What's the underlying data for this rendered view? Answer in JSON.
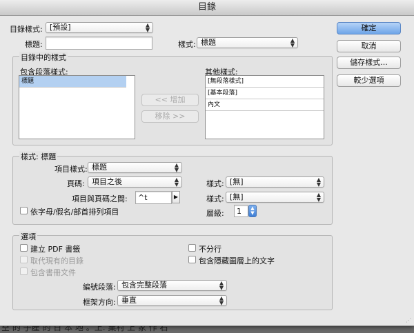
{
  "window": {
    "title": "目錄"
  },
  "top": {
    "toc_style_label": "目錄樣式:",
    "toc_style_value": "[預設]",
    "title_label": "標題:",
    "title_value": "",
    "style_label": "樣式:",
    "style_value": "標題"
  },
  "buttons": {
    "ok": "確定",
    "cancel": "取消",
    "save_style": "儲存樣式...",
    "fewer_options": "較少選項",
    "add": "<< 增加",
    "remove": "移除 >>"
  },
  "styles_in_toc": {
    "group_title": "目錄中的樣式",
    "include_label": "包含段落樣式:",
    "include_items": [
      "標題"
    ],
    "other_label": "其他樣式:",
    "other_items": [
      "[無段落樣式]",
      "[基本段落]",
      "內文"
    ]
  },
  "style_section": {
    "group_title": "樣式: 標題",
    "entry_style_label": "項目樣式:",
    "entry_style_value": "標題",
    "page_number_label": "頁碼:",
    "page_number_value": "項目之後",
    "between_label": "項目與頁碼之間:",
    "between_value": "^t",
    "style1_label": "樣式:",
    "style1_value": "[無]",
    "style2_label": "樣式:",
    "style2_value": "[無]",
    "level_label": "層級:",
    "level_value": "1",
    "sort_label": "依字母/假名/部首排列項目"
  },
  "options": {
    "group_title": "選項",
    "create_pdf": "建立 PDF 書籤",
    "replace_existing": "取代現有的目錄",
    "include_book": "包含書冊文件",
    "no_run_in": "不分行",
    "include_hidden": "包含隱藏圖層上的文字",
    "numbered_label": "編號段落:",
    "numbered_value": "包含完整段落",
    "frame_dir_label": "框架方向:",
    "frame_dir_value": "垂直"
  },
  "background_text": "空   的    子產    的    日   本    地     。上. 業村  上 家 作      石"
}
